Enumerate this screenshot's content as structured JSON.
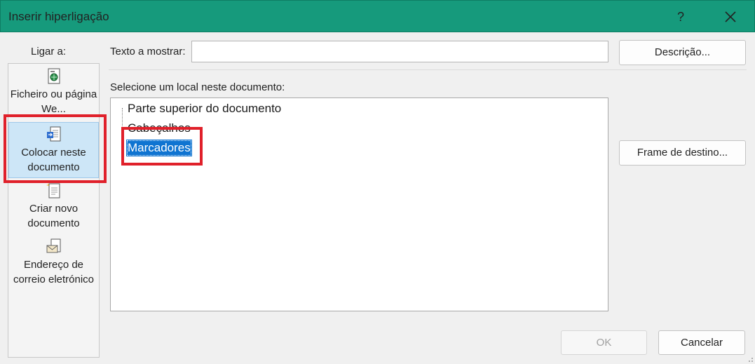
{
  "dialog": {
    "title": "Inserir hiperligação",
    "help_glyph": "?"
  },
  "link_to": {
    "label": "Ligar a:",
    "items": [
      {
        "label": "Ficheiro ou página We...",
        "icon": "web-file-icon",
        "selected": false
      },
      {
        "label": "Colocar neste documento",
        "icon": "place-in-document-icon",
        "selected": true
      },
      {
        "label": "Criar novo documento",
        "icon": "new-document-icon",
        "selected": false
      },
      {
        "label": "Endereço de correio eletrónico",
        "icon": "email-icon",
        "selected": false
      }
    ]
  },
  "text_to_display": {
    "label": "Texto a mostrar:",
    "value": ""
  },
  "buttons": {
    "description": "Descrição...",
    "target_frame": "Frame de destino...",
    "ok": "OK",
    "cancel": "Cancelar"
  },
  "place_in_document": {
    "label": "Selecione um local neste documento:",
    "tree": [
      {
        "label": "Parte superior do documento",
        "selected": false
      },
      {
        "label": "Cabeçalhos",
        "selected": false
      },
      {
        "label": "Marcadores",
        "selected": true
      }
    ]
  },
  "colors": {
    "titlebar": "#169a7c",
    "selection": "#0f74d1",
    "highlight_box": "#e0202a",
    "selected_item_bg": "#cde6f7"
  }
}
